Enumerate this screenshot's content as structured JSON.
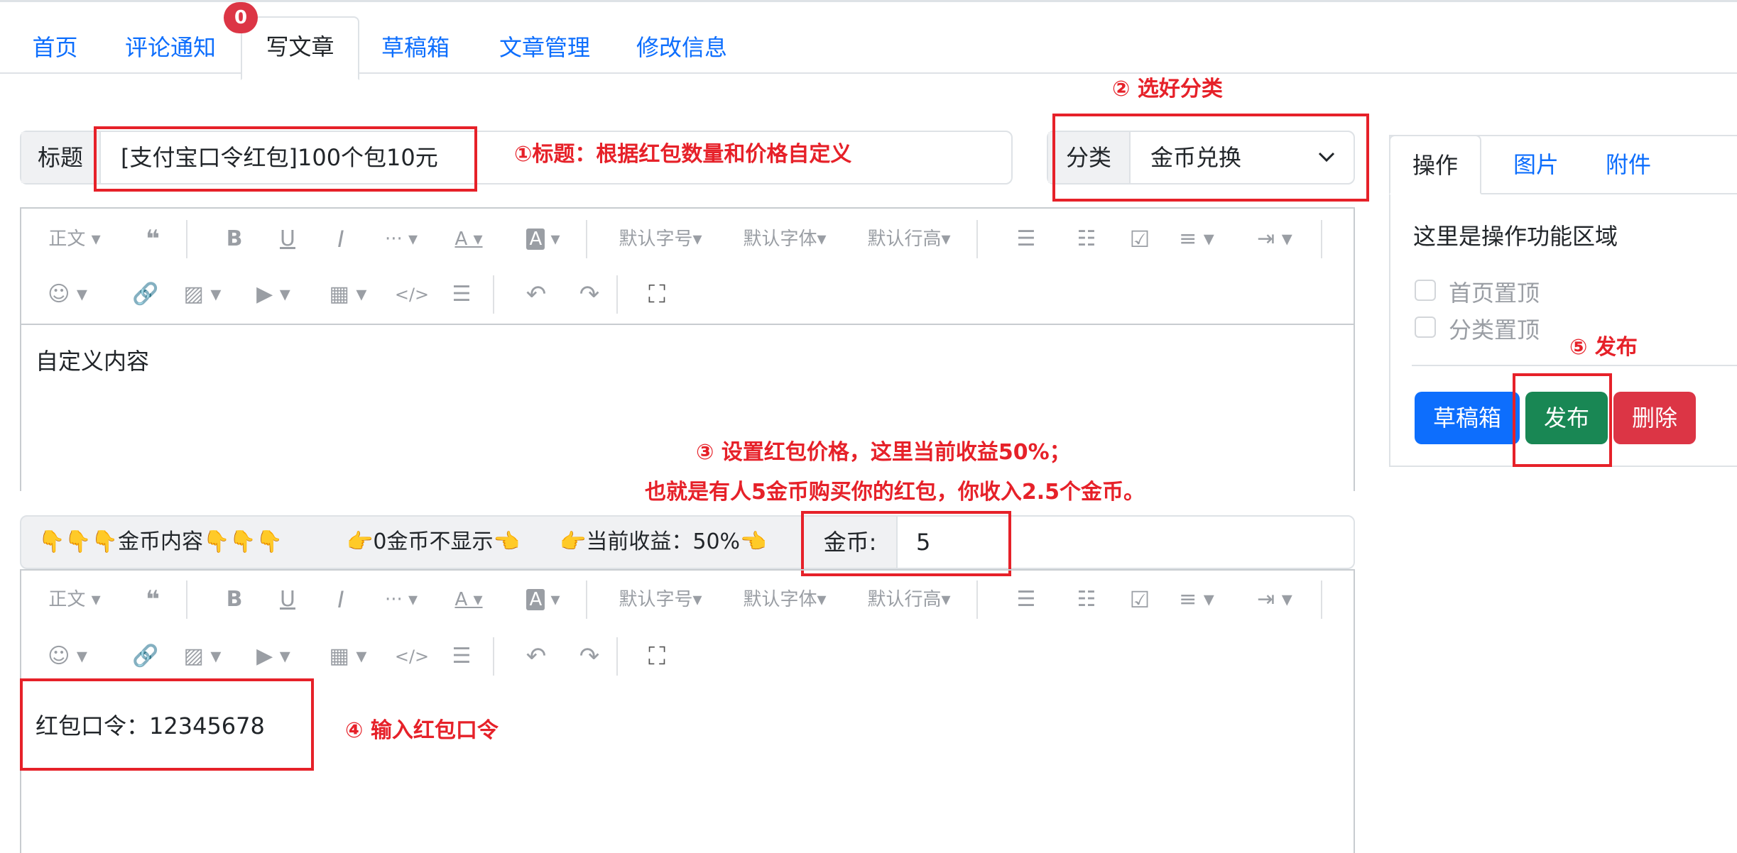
{
  "nav": {
    "tabs": [
      "首页",
      "评论通知",
      "写文章",
      "草稿箱",
      "文章管理",
      "修改信息"
    ],
    "badge": "0"
  },
  "title_group": {
    "label": "标题",
    "value": "[支付宝口令红包]100个包10元"
  },
  "category_group": {
    "label": "分类",
    "value": "金币兑换"
  },
  "toolbar": {
    "row1": [
      "正文",
      "“",
      "B",
      "U",
      "I",
      "···",
      "A",
      "A",
      "默认字号",
      "默认字体",
      "默认行高",
      "list",
      "numlist",
      "checklist",
      "align",
      "indent"
    ],
    "row1_text": {
      "para": "正文",
      "size": "默认字号",
      "font": "默认字体",
      "lineheight": "默认行高"
    }
  },
  "editor1": {
    "content": "自定义内容"
  },
  "coin_bar": {
    "text1": "👇👇👇金币内容👇👇👇",
    "text2": "👉0金币不显示👈",
    "text3": "👉当前收益：50%👈",
    "coin_label": "金币:",
    "coin_value": "5"
  },
  "editor2": {
    "content": "红包口令：12345678"
  },
  "side": {
    "tabs": [
      "操作",
      "图片",
      "附件"
    ],
    "desc": "这里是操作功能区域",
    "checks": [
      "首页置顶",
      "分类置顶"
    ],
    "buttons": {
      "draft": "草稿箱",
      "publish": "发布",
      "delete": "删除"
    }
  },
  "annotations": {
    "a1": "①标题：根据红包数量和价格自定义",
    "a2": "② 选好分类",
    "a3_line1": "③ 设置红包价格，这里当前收益50%；",
    "a3_line2": "也就是有人5金币购买你的红包，你收入2.5个金币。",
    "a4": "④  输入红包口令",
    "a5": "⑤ 发布"
  },
  "colors": {
    "primary": "#0d6efd",
    "success": "#198754",
    "danger": "#dc3545",
    "annotation": "#e62129"
  }
}
